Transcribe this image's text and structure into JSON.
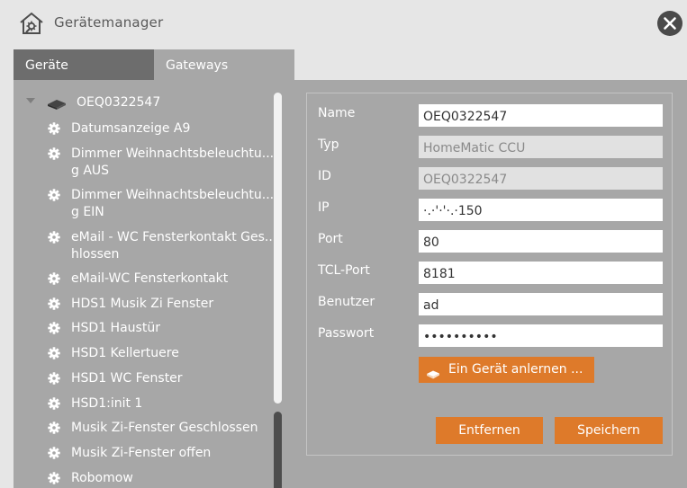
{
  "window": {
    "title": "Gerätemanager"
  },
  "tabs": [
    {
      "label": "Geräte",
      "active": true
    },
    {
      "label": "Gateways",
      "active": false
    }
  ],
  "tree": {
    "root_label": "OEQ0322547",
    "items": [
      "Datumsanzeige A9",
      "Dimmer Weihnachtsbeleuchtu... g AUS",
      "Dimmer Weihnachtsbeleuchtu... g EIN",
      "eMail - WC Fensterkontakt Ges... hlossen",
      "eMail-WC Fensterkontakt",
      "HDS1 Musik Zi Fenster",
      "HSD1 Haustür",
      "HSD1 Kellertuere",
      "HSD1 WC Fenster",
      "HSD1:init 1",
      "Musik Zi-Fenster Geschlossen",
      "Musik Zi-Fenster offen",
      "Robomow"
    ]
  },
  "form": {
    "fields": [
      {
        "label": "Name",
        "value": "OEQ0322547",
        "readonly": false
      },
      {
        "label": "Typ",
        "value": "HomeMatic CCU",
        "readonly": true
      },
      {
        "label": "ID",
        "value": "OEQ0322547",
        "readonly": true
      },
      {
        "label": "IP",
        "value": "·.·'·'·.·150",
        "readonly": false
      },
      {
        "label": "Port",
        "value": "80",
        "readonly": false
      },
      {
        "label": "TCL-Port",
        "value": "8181",
        "readonly": false
      },
      {
        "label": "Benutzer",
        "value": "ad",
        "readonly": false
      },
      {
        "label": "Passwort",
        "value": "••••••••••",
        "readonly": false
      }
    ],
    "learn_button": "Ein Gerät anlernen ...",
    "remove_button": "Entfernen",
    "save_button": "Speichern"
  },
  "colors": {
    "accent": "#de7a2a",
    "panel": "#a7a7a7",
    "active_tab": "#6d6d6d",
    "titlebar": "#e6e6e6"
  },
  "icons": {
    "app": "home-settings-icon",
    "close": "close-icon",
    "gateway": "gateway-device-icon",
    "device": "gear-icon",
    "learn": "learn-device-icon"
  }
}
